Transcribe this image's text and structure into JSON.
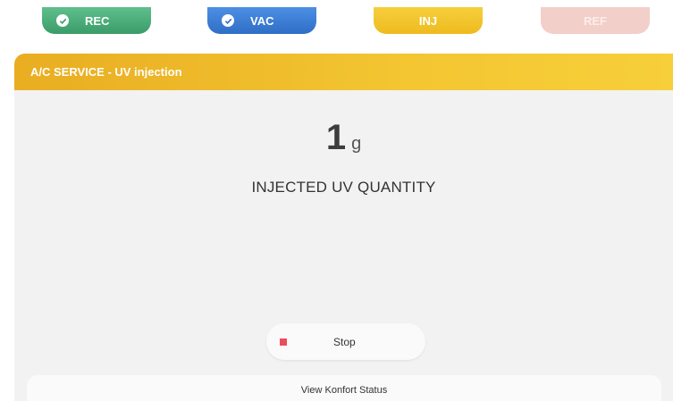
{
  "steps": [
    {
      "label": "REC",
      "done": true,
      "color": "#3a9c68"
    },
    {
      "label": "VAC",
      "done": true,
      "color": "#2f6fc6"
    },
    {
      "label": "INJ",
      "done": false,
      "color": "#eebb1f"
    },
    {
      "label": "REF",
      "done": false,
      "color": "#f3cfc9"
    }
  ],
  "panel": {
    "title": "A/C SERVICE - UV injection",
    "readout": {
      "value": "1",
      "unit": "g",
      "label": "INJECTED UV QUANTITY"
    },
    "stop_button": {
      "label": "Stop",
      "icon": "stop-icon",
      "icon_color": "#ee4c5d"
    },
    "status_link": {
      "label": "View Konfort Status"
    }
  },
  "colors": {
    "header_accent": "#f3c632"
  }
}
